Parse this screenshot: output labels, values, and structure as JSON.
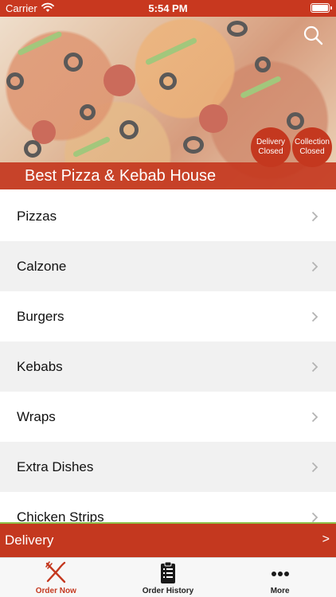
{
  "status_bar": {
    "carrier": "Carrier",
    "time": "5:54 PM"
  },
  "hero": {
    "restaurant_name": "Best Pizza & Kebab House",
    "delivery_status": {
      "line1": "Delivery",
      "line2": "Closed"
    },
    "collection_status": {
      "line1": "Collection",
      "line2": "Closed"
    }
  },
  "menu": {
    "categories": [
      {
        "label": "Pizzas"
      },
      {
        "label": "Calzone"
      },
      {
        "label": "Burgers"
      },
      {
        "label": "Kebabs"
      },
      {
        "label": "Wraps"
      },
      {
        "label": "Extra Dishes"
      },
      {
        "label": "Chicken Strips"
      }
    ]
  },
  "delivery_bar": {
    "mode": "Delivery",
    "arrow": ">"
  },
  "tab_bar": {
    "tabs": [
      {
        "label": "Order Now",
        "icon": "fork-knife-icon",
        "active": true
      },
      {
        "label": "Order History",
        "icon": "clipboard-icon",
        "active": false
      },
      {
        "label": "More",
        "icon": "ellipsis-icon",
        "active": false
      }
    ]
  },
  "colors": {
    "brand": "#c4381f",
    "accent_green": "#8fbf48",
    "row_alt": "#f1f1f1"
  }
}
